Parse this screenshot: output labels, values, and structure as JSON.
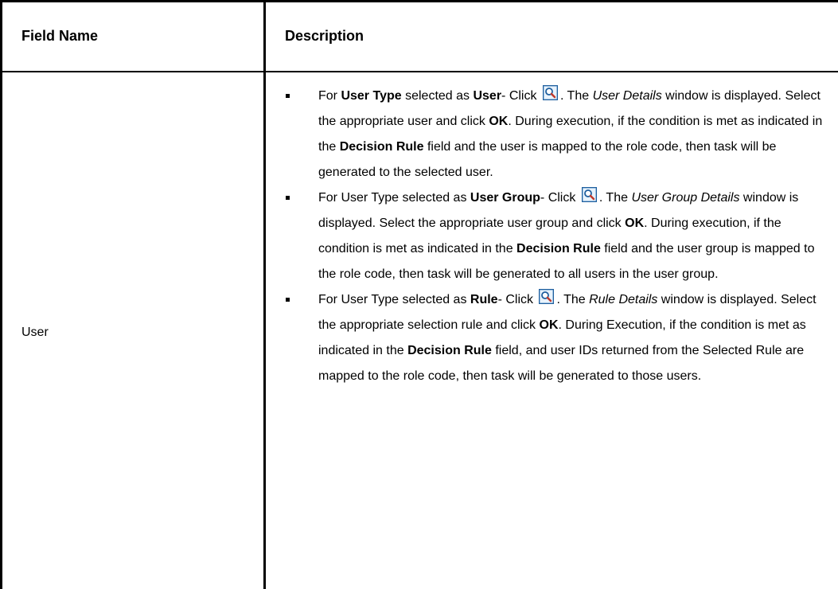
{
  "table": {
    "headers": {
      "field_name": "Field Name",
      "description": "Description"
    },
    "row": {
      "field": "User",
      "items": [
        {
          "p1": "For ",
          "b1": "User Type",
          "p2": " selected as ",
          "b2": "User",
          "p3": "- Click ",
          "p4": ". The ",
          "i1": "User Details",
          "p5": " window is displayed. Select the appropriate user and click ",
          "b3": "OK",
          "p6": ". During execution, if the condition is met as indicated in the ",
          "b4": "Decision Rule",
          "p7": " field and the user is mapped to the role code, then task will be generated to the selected user."
        },
        {
          "p1": "For User Type selected as ",
          "b1": "User Group",
          "p2": "- Click ",
          "p3": ". The ",
          "i1": "User Group Details",
          "p4": " window is displayed. Select the appropriate user group and click ",
          "b2": "OK",
          "p5": ". During execution, if the condition is met as indicated in the ",
          "b3": "Decision Rule",
          "p6": " field and the user group is mapped to the role code, then task will be generated to all users in the user group."
        },
        {
          "p1": "For User Type selected as ",
          "b1": "Rule",
          "p2": "- Click ",
          "p3": ". The ",
          "i1": "Rule Details",
          "p4": " window is displayed. Select the appropriate selection rule and click ",
          "b2": "OK",
          "p5": ". During Execution, if the condition is met as indicated in the ",
          "b3": "Decision Rule",
          "p6": " field, and user IDs returned from the Selected Rule are mapped to the role code, then task will be generated to those users."
        }
      ]
    }
  },
  "icons": {
    "lookup": "search-icon"
  },
  "colors": {
    "icon_frame": "#1f5f9e",
    "icon_fill": "#c9e2f7",
    "icon_handle": "#c0392b"
  }
}
